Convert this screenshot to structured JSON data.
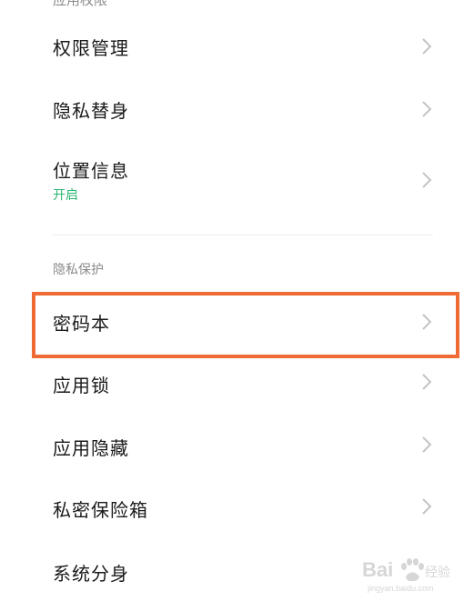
{
  "app_permissions": {
    "header": "应用权限",
    "items": [
      {
        "label": "权限管理"
      },
      {
        "label": "隐私替身"
      },
      {
        "label": "位置信息",
        "sub": "开启"
      }
    ]
  },
  "privacy_protection": {
    "header": "隐私保护",
    "items": [
      {
        "label": "密码本"
      },
      {
        "label": "应用锁"
      },
      {
        "label": "应用隐藏"
      },
      {
        "label": "私密保险箱"
      },
      {
        "label": "系统分身"
      }
    ]
  },
  "watermark": {
    "text": "Bai du 经验",
    "subtext": "jingyan.baidu.com"
  },
  "colors": {
    "highlight": "#f06a36",
    "status_on": "#2bb673",
    "chevron": "#c4c4c4"
  }
}
